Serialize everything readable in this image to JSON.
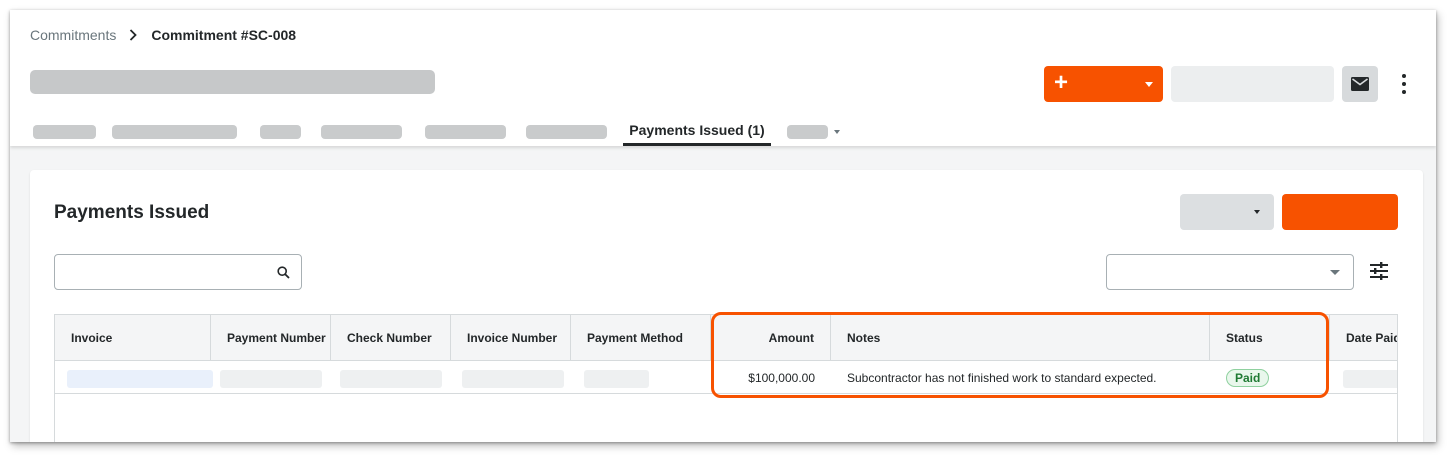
{
  "breadcrumb": {
    "parent": "Commitments",
    "current": "Commitment #SC-008"
  },
  "header": {
    "create_label": "+"
  },
  "tabs": {
    "active_label": "Payments Issued (1)"
  },
  "card": {
    "title": "Payments Issued"
  },
  "table": {
    "columns": {
      "invoice": "Invoice",
      "payment_number": "Payment Number",
      "check_number": "Check Number",
      "invoice_number": "Invoice Number",
      "payment_method": "Payment Method",
      "amount": "Amount",
      "notes": "Notes",
      "status": "Status",
      "date_paid": "Date Paid"
    },
    "rows": [
      {
        "amount": "$100,000.00",
        "notes": "Subcontractor has not finished work to standard expected.",
        "status": "Paid"
      }
    ]
  },
  "colors": {
    "accent": "#f75200",
    "status_paid": "#1f7a33"
  },
  "icons": [
    "chevron-right-icon",
    "mail-icon",
    "more-vertical-icon",
    "search-icon",
    "sliders-icon",
    "chevron-down-icon"
  ]
}
